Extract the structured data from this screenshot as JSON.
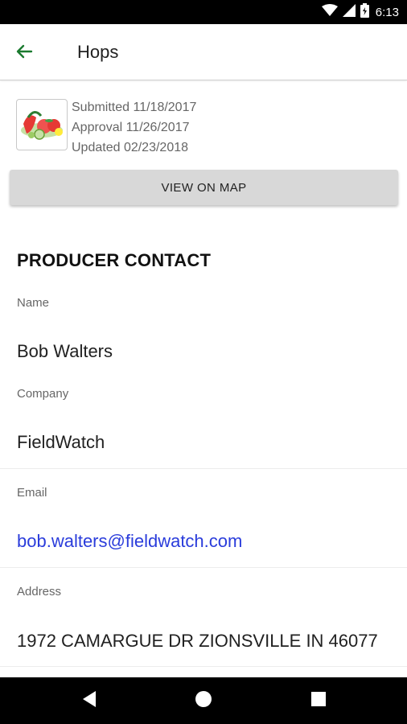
{
  "status_bar": {
    "time": "6:13",
    "icons": [
      "wifi-icon",
      "cell-signal-icon",
      "battery-icon"
    ]
  },
  "app_bar": {
    "title": "Hops",
    "back_icon": "arrow-back-icon",
    "accent_color": "#1b7a2f"
  },
  "record": {
    "thumbnail_icon": "vegetables-image",
    "submitted": "Submitted 11/18/2017",
    "approval": "Approval 11/26/2017",
    "updated": "Updated 02/23/2018"
  },
  "map_button": {
    "label": "VIEW ON MAP"
  },
  "producer_contact": {
    "title": "PRODUCER CONTACT",
    "name_label": "Name",
    "name_value": "Bob Walters",
    "company_label": "Company",
    "company_value": "FieldWatch",
    "email_label": "Email",
    "email_value": "bob.walters@fieldwatch.com",
    "address_label": "Address",
    "address_value": "1972 CAMARGUE DR ZIONSVILLE IN 46077"
  },
  "nav_bar": {
    "icons": [
      "nav-back-icon",
      "nav-home-icon",
      "nav-recents-icon"
    ]
  }
}
